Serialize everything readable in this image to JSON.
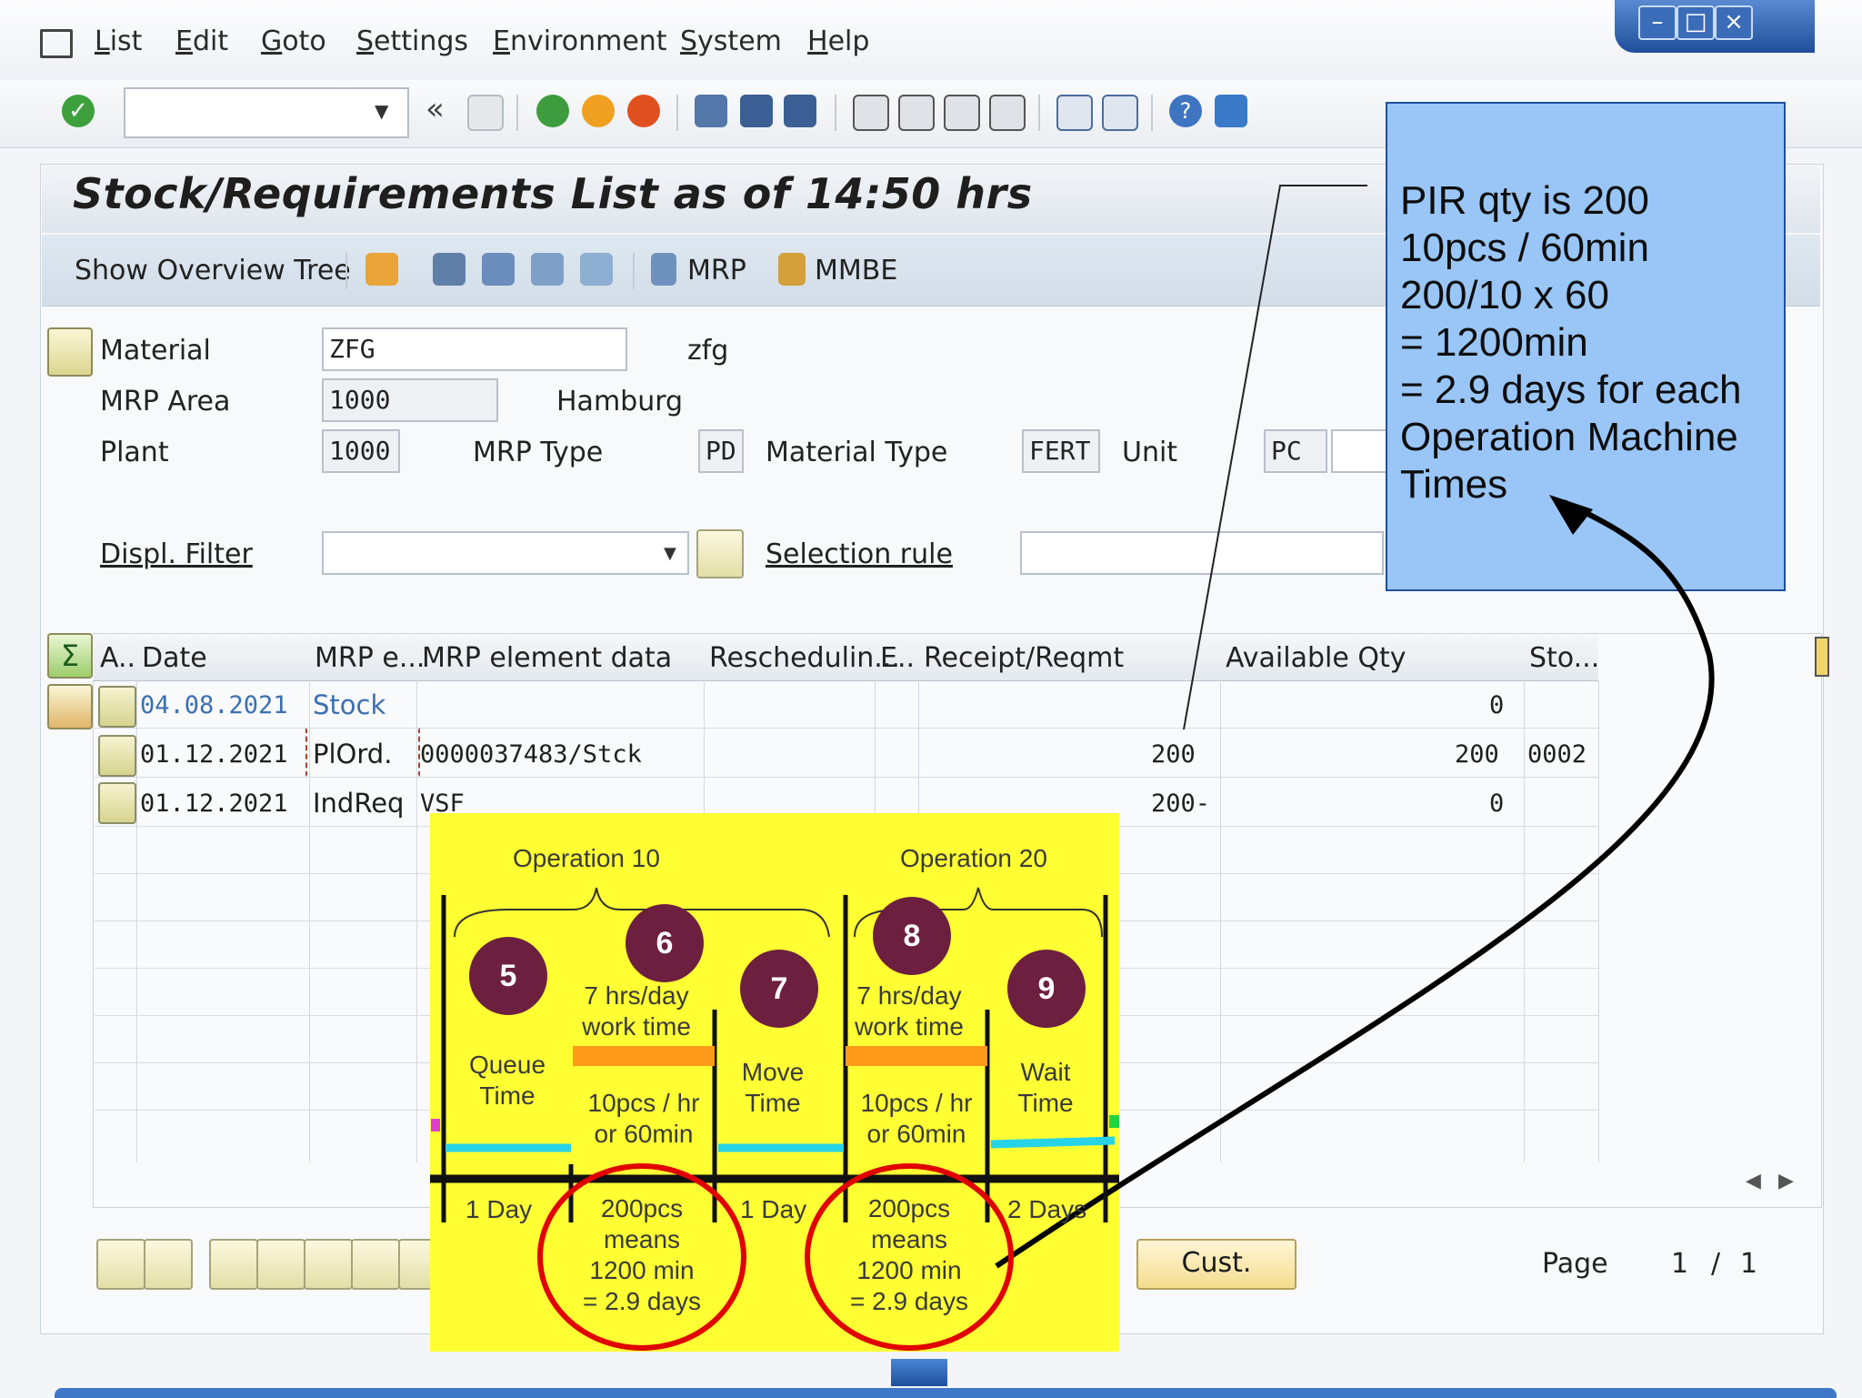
{
  "menu": [
    "List",
    "Edit",
    "Goto",
    "Settings",
    "Environment",
    "System",
    "Help"
  ],
  "title": "Stock/Requirements List as of 14:50 hrs",
  "app_toolbar": {
    "overview": "Show Overview Tree",
    "mrp": "MRP",
    "mmbe": "MMBE"
  },
  "header": {
    "material_label": "Material",
    "material_value": "ZFG",
    "material_desc": "zfg",
    "mrp_area_label": "MRP Area",
    "mrp_area_value": "1000",
    "mrp_area_desc": "Hamburg",
    "plant_label": "Plant",
    "plant_value": "1000",
    "mrp_type_label": "MRP Type",
    "mrp_type_value": "PD",
    "material_type_label": "Material Type",
    "material_type_value": "FERT",
    "unit_label": "Unit",
    "unit_value": "PC",
    "displ_filter_label": "Displ. Filter",
    "selection_rule_label": "Selection rule"
  },
  "table": {
    "columns": [
      "A..",
      "Date",
      "MRP e...",
      "MRP element data",
      "Reschedulin...",
      "E..",
      "Receipt/Reqmt",
      "Available Qty",
      "Sto..."
    ],
    "rows": [
      {
        "date": "04.08.2021",
        "element": "Stock",
        "data": "",
        "receipt": "",
        "available": "0",
        "sto": ""
      },
      {
        "date": "01.12.2021",
        "element": "PlOrd.",
        "data": "0000037483/Stck",
        "receipt": "200",
        "available": "200",
        "sto": "0002"
      },
      {
        "date": "01.12.2021",
        "element": "IndReq",
        "data": "VSF",
        "receipt": "200-",
        "available": "0",
        "sto": ""
      }
    ]
  },
  "bottom": {
    "cust": "Cust.",
    "page_label": "Page",
    "page_current": "1",
    "page_sep": "/",
    "page_total": "1"
  },
  "note": [
    "PIR qty is 200",
    "10pcs / 60min",
    "200/10 x 60",
    "= 1200min",
    "= 2.9 days for each",
    "Operation Machine",
    "Times"
  ],
  "diagram": {
    "op10": "Operation 10",
    "op20": "Operation 20",
    "steps": [
      "5",
      "6",
      "7",
      "8",
      "9"
    ],
    "queue": [
      "Queue",
      "Time"
    ],
    "work1": [
      "7 hrs/day",
      "work time"
    ],
    "rate1": [
      "10pcs / hr",
      "or 60min"
    ],
    "move": [
      "Move",
      "Time"
    ],
    "work2": [
      "7 hrs/day",
      "work time"
    ],
    "rate2": [
      "10pcs / hr",
      "or 60min"
    ],
    "wait": [
      "Wait",
      "Time"
    ],
    "d1": "1 Day",
    "d2": "1 Day",
    "d3": "2 Days",
    "calc1": [
      "200pcs",
      "means",
      "1200 min",
      "= 2.9 days"
    ],
    "calc2": [
      "200pcs",
      "means",
      "1200 min",
      "= 2.9 days"
    ]
  },
  "colors": {
    "note_bg": "#99c6f7",
    "diagram_bg": "#ffff33",
    "step_circle": "#6d1f3f",
    "highlight_ring": "#e00000"
  }
}
